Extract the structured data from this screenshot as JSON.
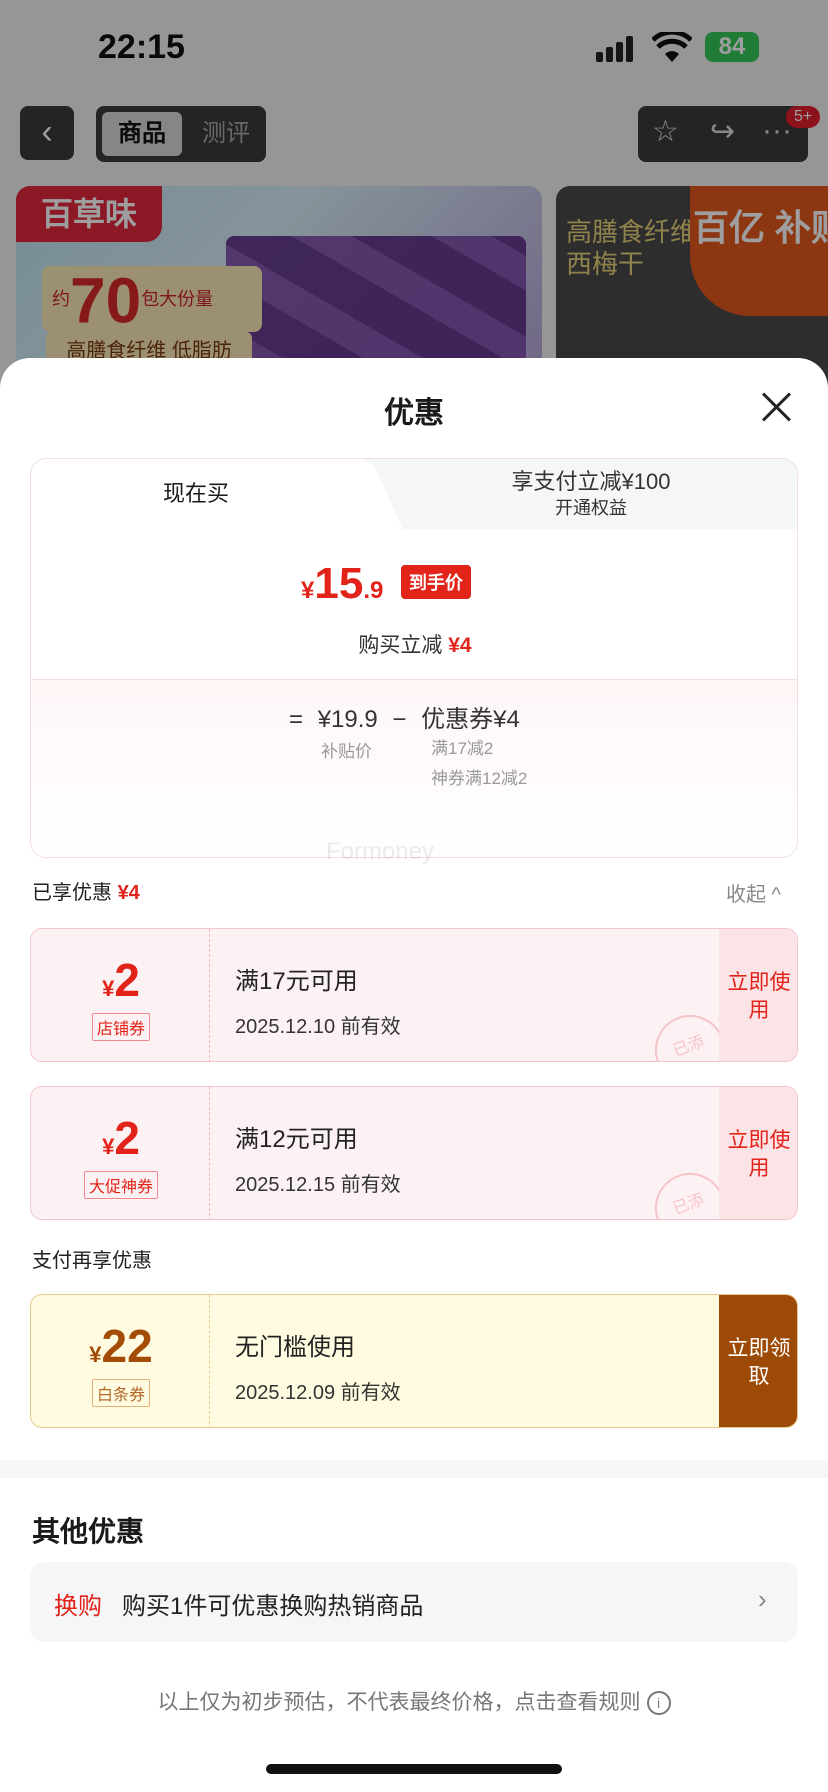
{
  "status": {
    "time": "22:15",
    "battery": "84"
  },
  "topbar": {
    "tab_active": "商品",
    "tab_inactive": "测评",
    "badge": "5+"
  },
  "banner_left": {
    "brand": "百草味",
    "qty_prefix": "约",
    "qty_num": "70",
    "qty_suffix": "包大份量",
    "tagline": "高膳食纤维 低脂肪"
  },
  "banner_right": {
    "text": "高膳食纤维 西梅干",
    "subsidy": "百亿 补贴"
  },
  "sheet": {
    "title": "优惠"
  },
  "tabs": {
    "now": "现在买",
    "pay_title": "享支付立减¥100",
    "pay_sub": "开通权益"
  },
  "price": {
    "currency": "¥",
    "int": "15",
    "dec": ".9",
    "tag": "到手价",
    "reduce_label": "购买立减",
    "reduce_value": "¥4"
  },
  "formula": {
    "eq": "=",
    "base": "¥19.9",
    "minus": "−",
    "coupon": "优惠券¥4",
    "base_label": "补贴价",
    "coupon_detail_1": "满17减2",
    "coupon_detail_2": "神券满12减2"
  },
  "watermark": "Formoney",
  "enjoyed": {
    "label": "已享优惠",
    "value": "¥4",
    "collapse": "收起 ^"
  },
  "coupons": [
    {
      "currency": "¥",
      "amount": "2",
      "type": "店铺券",
      "condition": "满17元可用",
      "valid": "2025.12.10 前有效",
      "action": "立即使用",
      "stamp": "已添"
    },
    {
      "currency": "¥",
      "amount": "2",
      "type": "大促神券",
      "condition": "满12元可用",
      "valid": "2025.12.15 前有效",
      "action": "立即使用",
      "stamp": "已添"
    }
  ],
  "pay_section": {
    "label": "支付再享优惠"
  },
  "pay_coupon": {
    "currency": "¥",
    "amount": "22",
    "type": "白条券",
    "condition": "无门槛使用",
    "valid": "2025.12.09 前有效",
    "action": "立即领取"
  },
  "other": {
    "title": "其他优惠",
    "swap_key": "换购",
    "swap_text": "购买1件可优惠换购热销商品",
    "arrow": "›"
  },
  "disclaimer": "以上仅为初步预估，不代表最终价格，点击查看规则"
}
